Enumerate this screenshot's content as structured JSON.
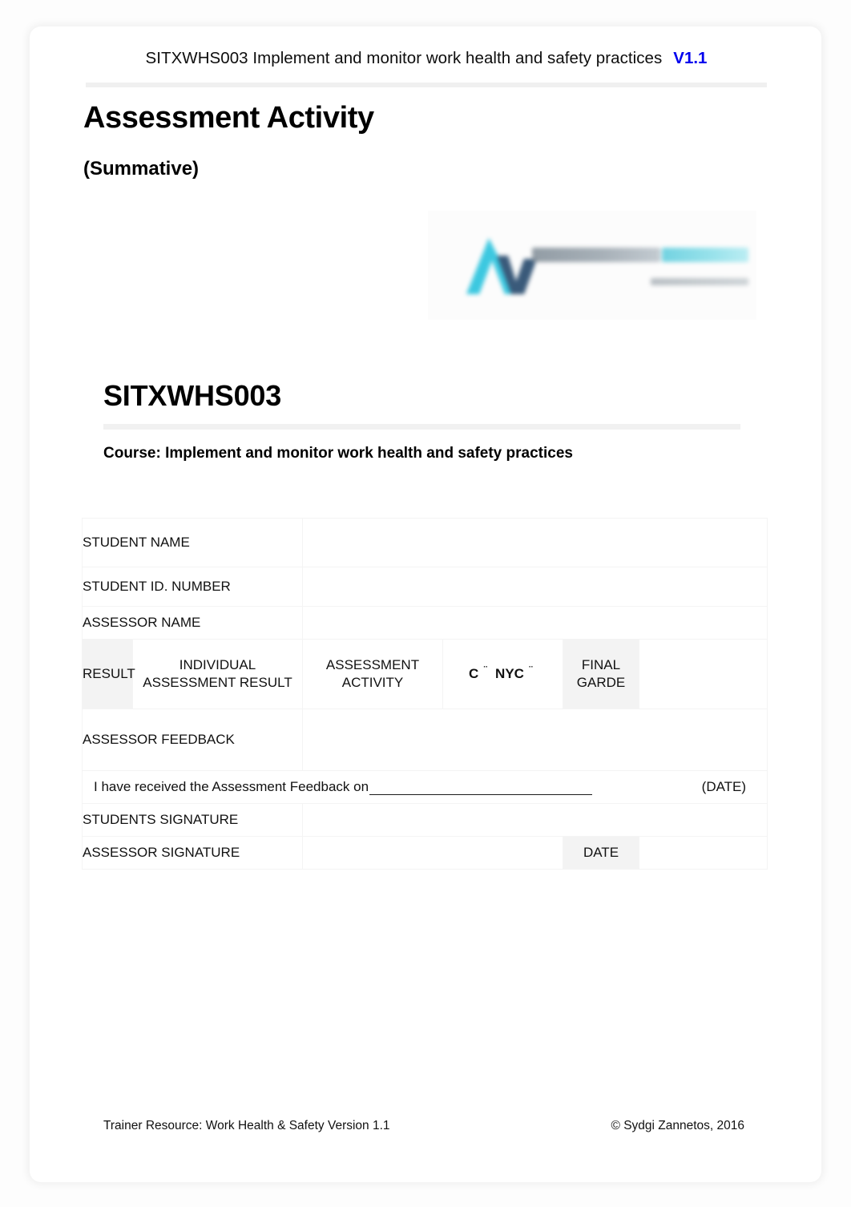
{
  "header": {
    "title": "SITXWHS003 Implement and monitor work health and safety practices",
    "version": "V1.1",
    "version_color": "#0000ee"
  },
  "titles": {
    "main": "Assessment Activity",
    "sub": "(Summative)"
  },
  "logo": {
    "name": "organisation-logo",
    "mark_letter": "A",
    "primary_color": "#3cc8e0",
    "secondary_color": "#3a5a7a",
    "blurred": true
  },
  "unit": {
    "code": "SITXWHS003",
    "course": "Course: Implement and monitor work health and safety practices"
  },
  "form": {
    "rows": {
      "student_name": "STUDENT NAME",
      "student_id": "STUDENT ID. NUMBER",
      "assessor_name": "ASSESSOR NAME",
      "result": "RESULT",
      "individual_assessment_result": "INDIVIDUAL ASSESSMENT RESULT",
      "assessment_activity": "ASSESSMENT ACTIVITY",
      "competent_label": "C",
      "competent_checkbox": "¨",
      "not_yet_competent_label": "NYC",
      "not_yet_competent_checkbox": "¨",
      "final_grade": "FINAL GARDE",
      "assessor_feedback": "ASSESSOR FEEDBACK",
      "received_text": "I have received the Assessment Feedback on",
      "received_date_label": "(DATE)",
      "students_signature": "STUDENTS SIGNATURE",
      "assessor_signature": "ASSESSOR SIGNATURE",
      "date": "DATE"
    },
    "values": {
      "student_name": "",
      "student_id": "",
      "assessor_name": "",
      "assessment_activity_value": "",
      "final_grade_value": "",
      "assessor_feedback_value": "",
      "students_signature_value": "",
      "assessor_signature_value": "",
      "date_value": ""
    },
    "shade_color": "#f3f3f3"
  },
  "footer": {
    "left": "Trainer Resource: Work Health & Safety Version 1.1",
    "right": "© Sydgi Zannetos, 2016"
  }
}
